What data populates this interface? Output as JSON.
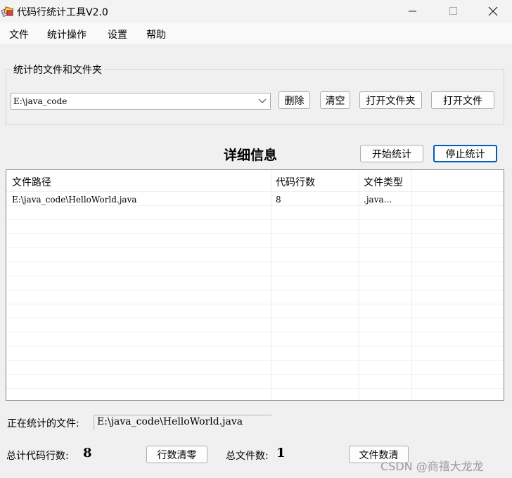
{
  "window": {
    "title": "代码行统计工具V2.0",
    "minimize_icon": "minimize-icon",
    "maximize_icon": "maximize-icon",
    "close_icon": "close-icon",
    "app_icon": "app-icon"
  },
  "menu": {
    "items": [
      "文件",
      "统计操作",
      "设置",
      "帮助"
    ]
  },
  "source_group": {
    "label": "统计的文件和文件夹",
    "path_value": "E:\\java_code",
    "delete_label": "删除",
    "clear_label": "清空",
    "open_folder_label": "打开文件夹",
    "open_file_label": "打开文件"
  },
  "detail": {
    "title": "详细信息",
    "start_label": "开始统计",
    "stop_label": "停止统计"
  },
  "table": {
    "columns": [
      "文件路径",
      "代码行数",
      "文件类型"
    ],
    "rows": [
      {
        "path": "E:\\java_code\\HelloWorld.java",
        "lines": "8",
        "type": ".java..."
      }
    ]
  },
  "status": {
    "current_file_label": "正在统计的文件:",
    "current_file_value": "E:\\java_code\\HelloWorld.java",
    "total_lines_label": "总计代码行数:",
    "total_lines_value": "8",
    "reset_lines_label": "行数清零",
    "total_files_label": "总文件数:",
    "total_files_value": "1",
    "reset_files_label": "文件数清"
  },
  "watermark": "CSDN @商禧大龙龙"
}
